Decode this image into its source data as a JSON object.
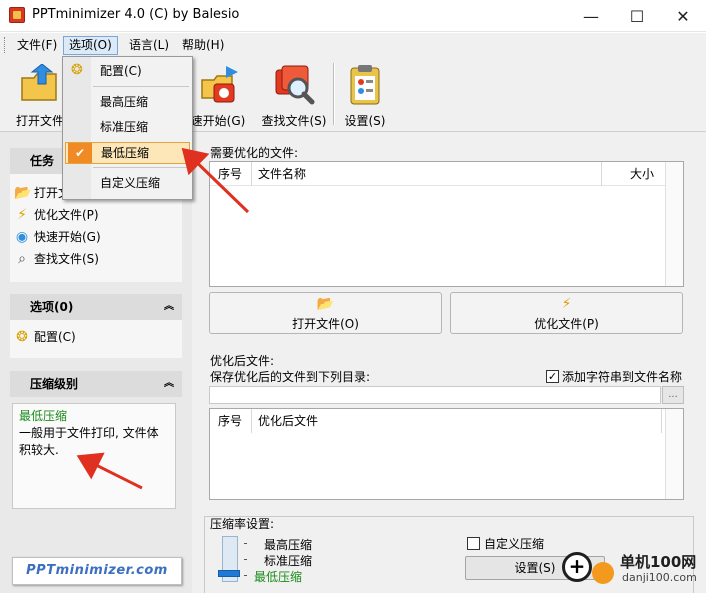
{
  "window": {
    "title": "PPTminimizer 4.0 (C) by Balesio",
    "minimize_glyph": "—",
    "maximize_glyph": "☐",
    "close_glyph": "✕"
  },
  "menu": {
    "file": "文件(F)",
    "options": "选项(O)",
    "language": "语言(L)",
    "help": "帮助(H)"
  },
  "toolbar": {
    "open": "打开文件",
    "quick_start": "速开始(G)",
    "find": "查找文件(S)",
    "settings": "设置(S)"
  },
  "options_menu": {
    "config": "配置(C)",
    "max": "最高压缩",
    "standard": "标准压缩",
    "min": "最低压缩",
    "custom": "自定义压缩",
    "check_glyph": "✔"
  },
  "tasks": {
    "header": "任务",
    "items": [
      "打开文",
      "优化文件(P)",
      "快速开始(G)",
      "查找文件(S)"
    ]
  },
  "options_group": {
    "header": "选项(0)",
    "config": "配置(C)"
  },
  "compression_group": {
    "header": "压缩级别",
    "title": "最低压缩",
    "description": "一般用于文件打印, 文件体积较大."
  },
  "brand": "PPTminimizer.com",
  "files_to_optimize": {
    "label": "需要优化的文件:",
    "col_index": "序号",
    "col_name": "文件名称",
    "col_size": "大小",
    "open_button": "打开文件(O)",
    "optimize_button": "优化文件(P)"
  },
  "optimized": {
    "label": "优化后文件:",
    "save_label": "保存优化后的文件到下列目录:",
    "path_value": "",
    "browse_button": "...",
    "append_checkbox": "添加字符串到文件名称",
    "append_checked": true,
    "col_index": "序号",
    "col_name": "优化后文件"
  },
  "compression_settings": {
    "label": "压缩率设置:",
    "levels": [
      "最高压缩",
      "标准压缩",
      "最低压缩"
    ],
    "current_level": "最低压缩",
    "custom_checkbox": "自定义压缩",
    "custom_checked": false,
    "settings_button": "设置(S)"
  },
  "watermark": {
    "name": "单机100网",
    "url": "danji100.com"
  },
  "colors": {
    "accent_highlight": "#fde7b8",
    "check_orange": "#f08a24",
    "green_status": "#1a8a1a",
    "arrow_red": "#e03020"
  }
}
